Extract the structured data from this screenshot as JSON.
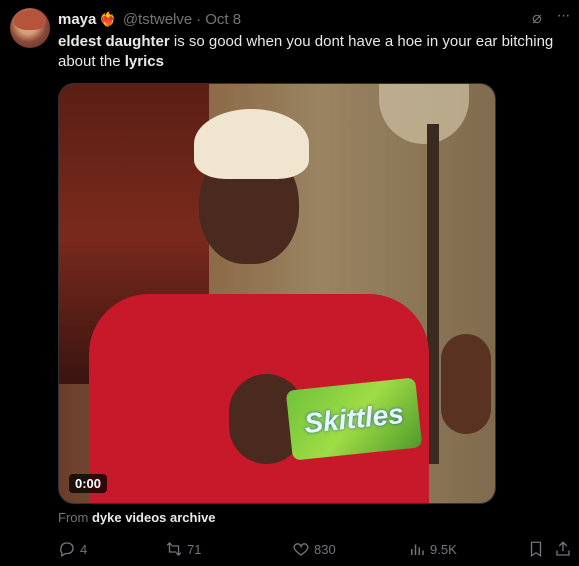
{
  "tweet": {
    "author_name": "maya",
    "author_emoji": "❤️‍🔥",
    "handle": "@tstwelve",
    "separator": "·",
    "date": "Oct 8",
    "text_bold_1": "eldest daughter",
    "text_1": " is so good when you dont have a hoe in your ear bitching about the ",
    "text_bold_2": "lyrics",
    "more_glyph": "···",
    "grok_glyph": "⌀"
  },
  "media": {
    "video_time": "0:00",
    "candy_text": "Skittles"
  },
  "source": {
    "prefix": "From ",
    "name": "dyke videos archive"
  },
  "actions": {
    "replies": "4",
    "retweets": "71",
    "likes": "830",
    "views": "9.5K"
  },
  "colors": {
    "background": "#000000",
    "text": "#e7e9ea",
    "muted": "#71767b"
  }
}
